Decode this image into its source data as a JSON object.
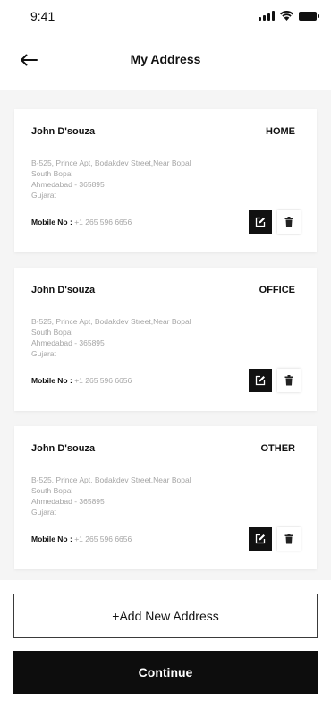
{
  "status_bar": {
    "time": "9:41",
    "icons": [
      "signal-icon",
      "wifi-icon",
      "battery-icon"
    ]
  },
  "header": {
    "back_icon": "arrow-left-icon",
    "title": "My Address"
  },
  "addresses": [
    {
      "name": "John D'souza",
      "type": "HOME",
      "line1": "B-525, Prince Apt, Bodakdev Street,Near Bopal",
      "line2": "South Bopal",
      "line3": "Ahmedabad - 365895",
      "line4": "Gujarat",
      "mobile_label": "Mobile No :",
      "mobile": "+1 265 596 6656"
    },
    {
      "name": "John D'souza",
      "type": "OFFICE",
      "line1": "B-525, Prince Apt, Bodakdev Street,Near Bopal",
      "line2": "South Bopal",
      "line3": "Ahmedabad - 365895",
      "line4": "Gujarat",
      "mobile_label": "Mobile No :",
      "mobile": "+1 265 596 6656"
    },
    {
      "name": "John D'souza",
      "type": "OTHER",
      "line1": "B-525, Prince Apt, Bodakdev Street,Near Bopal",
      "line2": "South Bopal",
      "line3": "Ahmedabad - 365895",
      "line4": "Gujarat",
      "mobile_label": "Mobile No :",
      "mobile": "+1 265 596 6656"
    }
  ],
  "card_icons": {
    "edit": "edit-icon",
    "delete": "trash-icon"
  },
  "buttons": {
    "add_new": "+Add New Address",
    "continue": "Continue"
  },
  "colors": {
    "primary": "#0d0d0d",
    "list_background": "#f5f5f5",
    "secondary_text": "#a5a5a5"
  }
}
